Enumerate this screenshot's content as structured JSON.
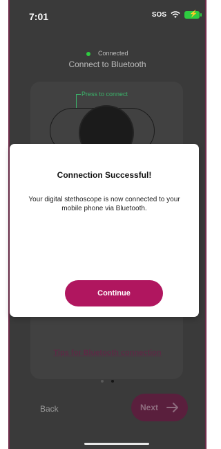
{
  "status_bar": {
    "time": "7:01",
    "carrier": "SOS"
  },
  "connection": {
    "status": "Connected",
    "heading": "Connect to Bluetooth",
    "press_label": "Press to connect"
  },
  "modal": {
    "title": "Connection Successful!",
    "message": "Your digital stethoscope is now connected to your mobile phone via Bluetooth.",
    "continue_label": "Continue"
  },
  "tips_link": "Tips for Bluetooth connection",
  "pagination": {
    "current_page": 2,
    "total_pages": 2
  },
  "navigation": {
    "back_label": "Back",
    "next_label": "Next"
  },
  "colors": {
    "accent": "#b0165f",
    "connected": "#2ecc40",
    "modal_bg": "#ffffff"
  },
  "icons": [
    "wifi-icon",
    "battery-icon",
    "connected-dot-icon",
    "arrow-right-icon",
    "stethoscope-device-icon"
  ]
}
